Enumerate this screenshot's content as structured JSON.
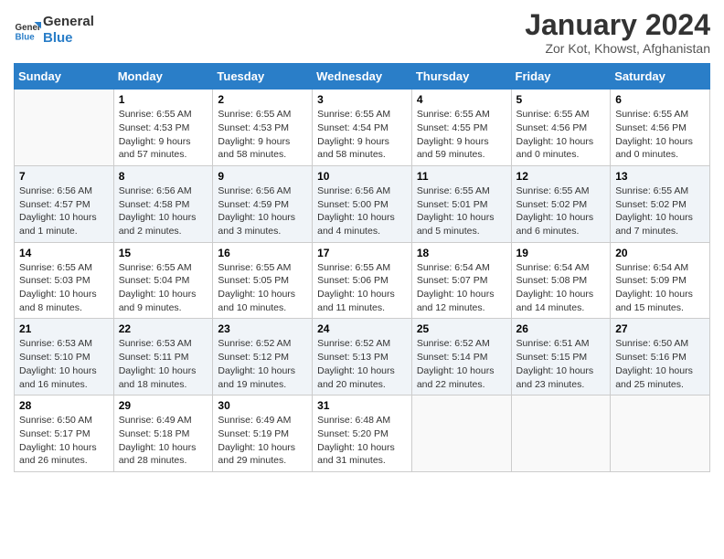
{
  "header": {
    "logo_line1": "General",
    "logo_line2": "Blue",
    "month_title": "January 2024",
    "location": "Zor Kot, Khowst, Afghanistan"
  },
  "days_of_week": [
    "Sunday",
    "Monday",
    "Tuesday",
    "Wednesday",
    "Thursday",
    "Friday",
    "Saturday"
  ],
  "weeks": [
    [
      {
        "day": "",
        "info": ""
      },
      {
        "day": "1",
        "info": "Sunrise: 6:55 AM\nSunset: 4:53 PM\nDaylight: 9 hours\nand 57 minutes."
      },
      {
        "day": "2",
        "info": "Sunrise: 6:55 AM\nSunset: 4:53 PM\nDaylight: 9 hours\nand 58 minutes."
      },
      {
        "day": "3",
        "info": "Sunrise: 6:55 AM\nSunset: 4:54 PM\nDaylight: 9 hours\nand 58 minutes."
      },
      {
        "day": "4",
        "info": "Sunrise: 6:55 AM\nSunset: 4:55 PM\nDaylight: 9 hours\nand 59 minutes."
      },
      {
        "day": "5",
        "info": "Sunrise: 6:55 AM\nSunset: 4:56 PM\nDaylight: 10 hours\nand 0 minutes."
      },
      {
        "day": "6",
        "info": "Sunrise: 6:55 AM\nSunset: 4:56 PM\nDaylight: 10 hours\nand 0 minutes."
      }
    ],
    [
      {
        "day": "7",
        "info": "Sunrise: 6:56 AM\nSunset: 4:57 PM\nDaylight: 10 hours\nand 1 minute."
      },
      {
        "day": "8",
        "info": "Sunrise: 6:56 AM\nSunset: 4:58 PM\nDaylight: 10 hours\nand 2 minutes."
      },
      {
        "day": "9",
        "info": "Sunrise: 6:56 AM\nSunset: 4:59 PM\nDaylight: 10 hours\nand 3 minutes."
      },
      {
        "day": "10",
        "info": "Sunrise: 6:56 AM\nSunset: 5:00 PM\nDaylight: 10 hours\nand 4 minutes."
      },
      {
        "day": "11",
        "info": "Sunrise: 6:55 AM\nSunset: 5:01 PM\nDaylight: 10 hours\nand 5 minutes."
      },
      {
        "day": "12",
        "info": "Sunrise: 6:55 AM\nSunset: 5:02 PM\nDaylight: 10 hours\nand 6 minutes."
      },
      {
        "day": "13",
        "info": "Sunrise: 6:55 AM\nSunset: 5:02 PM\nDaylight: 10 hours\nand 7 minutes."
      }
    ],
    [
      {
        "day": "14",
        "info": "Sunrise: 6:55 AM\nSunset: 5:03 PM\nDaylight: 10 hours\nand 8 minutes."
      },
      {
        "day": "15",
        "info": "Sunrise: 6:55 AM\nSunset: 5:04 PM\nDaylight: 10 hours\nand 9 minutes."
      },
      {
        "day": "16",
        "info": "Sunrise: 6:55 AM\nSunset: 5:05 PM\nDaylight: 10 hours\nand 10 minutes."
      },
      {
        "day": "17",
        "info": "Sunrise: 6:55 AM\nSunset: 5:06 PM\nDaylight: 10 hours\nand 11 minutes."
      },
      {
        "day": "18",
        "info": "Sunrise: 6:54 AM\nSunset: 5:07 PM\nDaylight: 10 hours\nand 12 minutes."
      },
      {
        "day": "19",
        "info": "Sunrise: 6:54 AM\nSunset: 5:08 PM\nDaylight: 10 hours\nand 14 minutes."
      },
      {
        "day": "20",
        "info": "Sunrise: 6:54 AM\nSunset: 5:09 PM\nDaylight: 10 hours\nand 15 minutes."
      }
    ],
    [
      {
        "day": "21",
        "info": "Sunrise: 6:53 AM\nSunset: 5:10 PM\nDaylight: 10 hours\nand 16 minutes."
      },
      {
        "day": "22",
        "info": "Sunrise: 6:53 AM\nSunset: 5:11 PM\nDaylight: 10 hours\nand 18 minutes."
      },
      {
        "day": "23",
        "info": "Sunrise: 6:52 AM\nSunset: 5:12 PM\nDaylight: 10 hours\nand 19 minutes."
      },
      {
        "day": "24",
        "info": "Sunrise: 6:52 AM\nSunset: 5:13 PM\nDaylight: 10 hours\nand 20 minutes."
      },
      {
        "day": "25",
        "info": "Sunrise: 6:52 AM\nSunset: 5:14 PM\nDaylight: 10 hours\nand 22 minutes."
      },
      {
        "day": "26",
        "info": "Sunrise: 6:51 AM\nSunset: 5:15 PM\nDaylight: 10 hours\nand 23 minutes."
      },
      {
        "day": "27",
        "info": "Sunrise: 6:50 AM\nSunset: 5:16 PM\nDaylight: 10 hours\nand 25 minutes."
      }
    ],
    [
      {
        "day": "28",
        "info": "Sunrise: 6:50 AM\nSunset: 5:17 PM\nDaylight: 10 hours\nand 26 minutes."
      },
      {
        "day": "29",
        "info": "Sunrise: 6:49 AM\nSunset: 5:18 PM\nDaylight: 10 hours\nand 28 minutes."
      },
      {
        "day": "30",
        "info": "Sunrise: 6:49 AM\nSunset: 5:19 PM\nDaylight: 10 hours\nand 29 minutes."
      },
      {
        "day": "31",
        "info": "Sunrise: 6:48 AM\nSunset: 5:20 PM\nDaylight: 10 hours\nand 31 minutes."
      },
      {
        "day": "",
        "info": ""
      },
      {
        "day": "",
        "info": ""
      },
      {
        "day": "",
        "info": ""
      }
    ]
  ]
}
